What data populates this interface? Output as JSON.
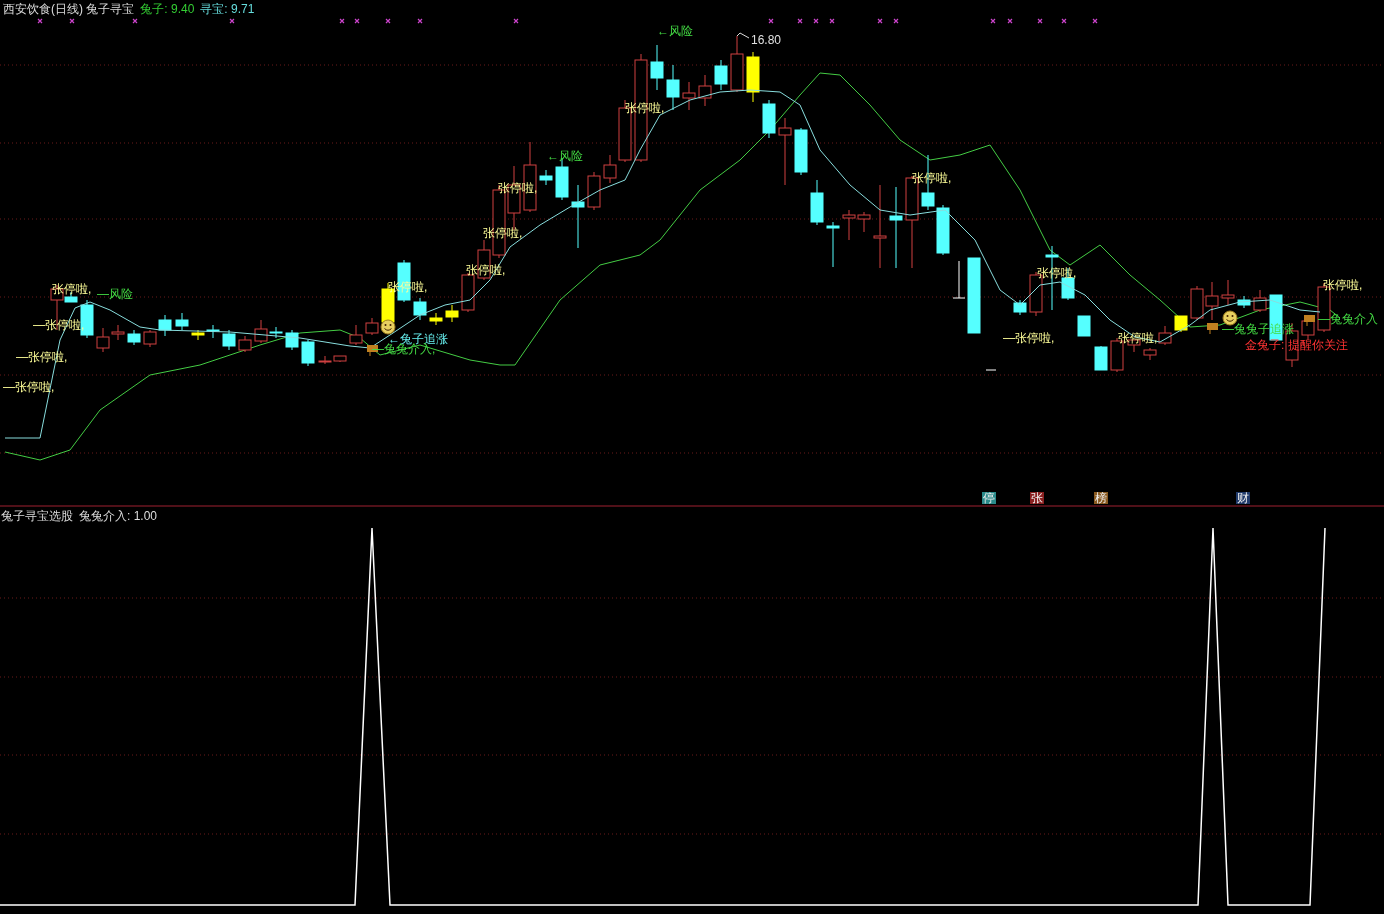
{
  "main_chart": {
    "title": "西安饮食(日线) 兔子寻宝",
    "indicators": [
      {
        "label": "兔子: 9.40",
        "color": "#33cc33"
      },
      {
        "label": "寻宝: 9.71",
        "color": "#66dddd"
      }
    ],
    "annotations": [
      {
        "kind": "limit",
        "text": "张停啦,"
      },
      {
        "kind": "risk",
        "text": "—风险"
      },
      {
        "kind": "limit",
        "text": "—张停啦,"
      },
      {
        "kind": "limit",
        "text": "—张停啦,"
      },
      {
        "kind": "limit",
        "text": "—张停啦,"
      },
      {
        "kind": "limit",
        "text": "张停啦,"
      },
      {
        "kind": "chase",
        "text": "←兔子追涨"
      },
      {
        "kind": "enter",
        "text": "—兔兔介入,"
      },
      {
        "kind": "limit",
        "text": "张停啦,"
      },
      {
        "kind": "limit",
        "text": "张停啦,"
      },
      {
        "kind": "limit",
        "text": "张停啦,"
      },
      {
        "kind": "risk",
        "text": "←风险"
      },
      {
        "kind": "limit",
        "text": "张停啦,"
      },
      {
        "kind": "risk",
        "text": "←风险"
      },
      {
        "kind": "price",
        "text": "16.80"
      },
      {
        "kind": "limit",
        "text": "张停啦,"
      },
      {
        "kind": "limit",
        "text": "张停啦,"
      },
      {
        "kind": "limit",
        "text": "—张停啦,"
      },
      {
        "kind": "limit",
        "text": "张停啦,"
      },
      {
        "kind": "limit",
        "text": "张停啦,"
      },
      {
        "kind": "enter",
        "text": "—兔兔子追涨"
      },
      {
        "kind": "enter",
        "text": "—兔兔介入"
      },
      {
        "kind": "alert",
        "text": "金兔子: 提醒你关注"
      }
    ],
    "markers": [
      {
        "text": "停",
        "color": "#2a8a8a"
      },
      {
        "text": "张",
        "color": "#8a2020"
      },
      {
        "text": "榜",
        "color": "#8a5a20"
      },
      {
        "text": "财",
        "color": "#203a6a"
      }
    ]
  },
  "sub_chart": {
    "title": "兔子寻宝选股",
    "reading": "兔兔介入: 1.00"
  }
}
